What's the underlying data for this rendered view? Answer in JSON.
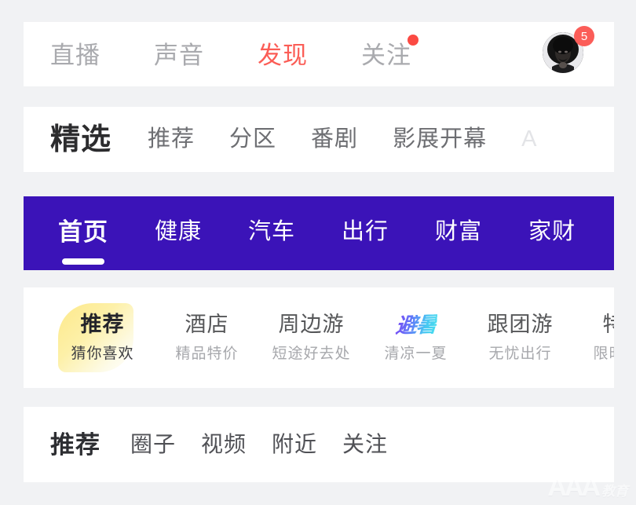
{
  "page": {
    "background_color": "#f1f2f4",
    "card_color": "#ffffff"
  },
  "row_top": {
    "name": "top-tab-bar",
    "items": [
      {
        "label": "直播",
        "active": false,
        "dot": false
      },
      {
        "label": "声音",
        "active": false,
        "dot": false
      },
      {
        "label": "发现",
        "active": true,
        "dot": false
      },
      {
        "label": "关注",
        "active": false,
        "dot": true
      }
    ],
    "active_color": "#fb5d56",
    "inactive_color": "#a9aaae",
    "dot_color": "#fb4a43",
    "avatar": {
      "name": "user-avatar",
      "badge_count": "5",
      "badge_color": "#fb5d58"
    }
  },
  "row_featured": {
    "name": "featured-tab-bar",
    "lead": {
      "label": "精选",
      "underline_gradient_from": "#fb4f50",
      "underline_gradient_to": "#fdeceb"
    },
    "items": [
      {
        "label": "推荐",
        "faded": false
      },
      {
        "label": "分区",
        "faded": false
      },
      {
        "label": "番剧",
        "faded": false
      },
      {
        "label": "影展开幕",
        "faded": false
      },
      {
        "label": "A",
        "faded": true
      }
    ]
  },
  "row_purple": {
    "name": "purple-channel-bar",
    "background_color": "#3b13b8",
    "text_color": "#ffffff",
    "items": [
      {
        "label": "首页",
        "active": true
      },
      {
        "label": "健康",
        "active": false
      },
      {
        "label": "汽车",
        "active": false
      },
      {
        "label": "出行",
        "active": false
      },
      {
        "label": "财富",
        "active": false
      },
      {
        "label": "家财",
        "active": false
      }
    ]
  },
  "row_travel": {
    "name": "travel-category-bar",
    "highlight_color": "#fde98a",
    "items": [
      {
        "title": "推荐",
        "subtitle": "猜你喜欢",
        "highlighted": true,
        "logo": false
      },
      {
        "title": "酒店",
        "subtitle": "精品特价",
        "highlighted": false,
        "logo": false
      },
      {
        "title": "周边游",
        "subtitle": "短途好去处",
        "highlighted": false,
        "logo": false
      },
      {
        "title": "避暑",
        "subtitle": "清凉一夏",
        "highlighted": false,
        "logo": true
      },
      {
        "title": "跟团游",
        "subtitle": "无忧出行",
        "highlighted": false,
        "logo": false
      },
      {
        "title": "特价",
        "subtitle": "限时优惠",
        "highlighted": false,
        "logo": false
      }
    ]
  },
  "row_bottom": {
    "name": "bottom-tab-bar",
    "lead": {
      "label": "推荐",
      "dot_color": "#fcd730"
    },
    "items": [
      {
        "label": "圈子"
      },
      {
        "label": "视频"
      },
      {
        "label": "附近"
      },
      {
        "label": "关注"
      }
    ]
  },
  "watermark": {
    "primary": "AAA",
    "secondary": "教育"
  }
}
